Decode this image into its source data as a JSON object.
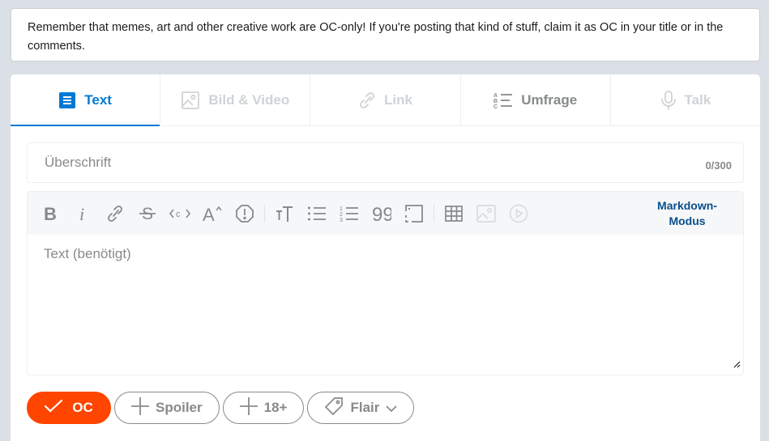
{
  "notice": {
    "text": "Remember that memes, art and other creative work are OC-only! If you're posting that kind of stuff, claim it as OC in your title or in the comments."
  },
  "tabs": [
    {
      "label": "Text",
      "icon": "post-text-icon",
      "state": "active"
    },
    {
      "label": "Bild & Video",
      "icon": "image-icon",
      "state": "disabled"
    },
    {
      "label": "Link",
      "icon": "link-icon",
      "state": "disabled"
    },
    {
      "label": "Umfrage",
      "icon": "poll-icon",
      "state": "enabled"
    },
    {
      "label": "Talk",
      "icon": "microphone-icon",
      "state": "disabled"
    }
  ],
  "title_input": {
    "placeholder": "Überschrift",
    "value": "",
    "counter": "0/300"
  },
  "editor": {
    "placeholder": "Text (benötigt)",
    "markdown_mode_label": "Markdown-Modus",
    "toolbar": [
      "bold-icon",
      "italic-icon",
      "link-icon",
      "strikethrough-icon",
      "inline-code-icon",
      "superscript-icon",
      "spoiler-icon",
      "heading-icon",
      "bulleted-list-icon",
      "numbered-list-icon",
      "quote-block-icon",
      "code-block-icon",
      "table-icon",
      "image-icon",
      "video-icon"
    ]
  },
  "actions": {
    "oc_label": "OC",
    "spoiler_label": "Spoiler",
    "nsfw_label": "18+",
    "flair_label": "Flair"
  },
  "colors": {
    "background": "#dae0e6",
    "accent": "#0079d3",
    "oc": "#ff4500",
    "muted": "#878a8c",
    "markdown_link": "#0a4f8c"
  }
}
